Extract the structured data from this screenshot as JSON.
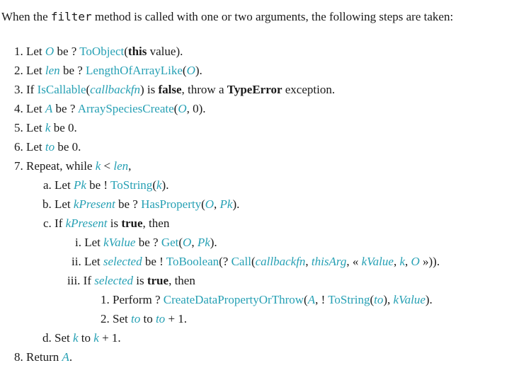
{
  "intro": {
    "before": "When the ",
    "code": "filter",
    "after": " method is called with one or two arguments, the following steps are taken:"
  },
  "steps": {
    "s1": {
      "num": "1.",
      "t1": "Let ",
      "v1": "O",
      "t2": " be ? ",
      "op1": "ToObject",
      "t3": "(",
      "k1": "this",
      "t4": " value)."
    },
    "s2": {
      "num": "2.",
      "t1": "Let ",
      "v1": "len",
      "t2": " be ? ",
      "op1": "LengthOfArrayLike",
      "t3": "(",
      "v2": "O",
      "t4": ")."
    },
    "s3": {
      "num": "3.",
      "t1": "If ",
      "op1": "IsCallable",
      "t2": "(",
      "v1": "callbackfn",
      "t3": ") is ",
      "k1": "false",
      "t4": ", throw a ",
      "k2": "TypeError",
      "t5": " exception."
    },
    "s4": {
      "num": "4.",
      "t1": "Let ",
      "v1": "A",
      "t2": " be ? ",
      "op1": "ArraySpeciesCreate",
      "t3": "(",
      "v2": "O",
      "t4": ", 0)."
    },
    "s5": {
      "num": "5.",
      "t1": "Let ",
      "v1": "k",
      "t2": " be 0."
    },
    "s6": {
      "num": "6.",
      "t1": "Let ",
      "v1": "to",
      "t2": " be 0."
    },
    "s7": {
      "num": "7.",
      "t1": "Repeat, while ",
      "v1": "k",
      "t2": " < ",
      "v2": "len",
      "t3": ","
    },
    "s7a": {
      "num": "a.",
      "t1": "Let ",
      "v1": "Pk",
      "t2": " be ! ",
      "op1": "ToString",
      "t3": "(",
      "v2": "k",
      "t4": ")."
    },
    "s7b": {
      "num": "b.",
      "t1": "Let ",
      "v1": "kPresent",
      "t2": " be ? ",
      "op1": "HasProperty",
      "t3": "(",
      "v2": "O",
      "t4": ", ",
      "v3": "Pk",
      "t5": ")."
    },
    "s7c": {
      "num": "c.",
      "t1": "If ",
      "v1": "kPresent",
      "t2": " is ",
      "k1": "true",
      "t3": ", then"
    },
    "s7ci": {
      "num": "i.",
      "t1": "Let ",
      "v1": "kValue",
      "t2": " be ? ",
      "op1": "Get",
      "t3": "(",
      "v2": "O",
      "t4": ", ",
      "v3": "Pk",
      "t5": ")."
    },
    "s7cii": {
      "num": "ii.",
      "t1": "Let ",
      "v1": "selected",
      "t2": " be ! ",
      "op1": "ToBoolean",
      "t3": "(? ",
      "op2": "Call",
      "t4": "(",
      "v2": "callbackfn",
      "t5": ", ",
      "v3": "thisArg",
      "t6": ", « ",
      "v4": "kValue",
      "t7": ", ",
      "v5": "k",
      "t8": ", ",
      "v6": "O",
      "t9": " »))."
    },
    "s7ciii": {
      "num": "iii.",
      "t1": "If ",
      "v1": "selected",
      "t2": " is ",
      "k1": "true",
      "t3": ", then"
    },
    "s7ciii1": {
      "num": "1.",
      "t1": "Perform ? ",
      "op1": "CreateDataPropertyOrThrow",
      "t2": "(",
      "v1": "A",
      "t3": ", ! ",
      "op2": "ToString",
      "t4": "(",
      "v2": "to",
      "t5": "), ",
      "v3": "kValue",
      "t6": ")."
    },
    "s7ciii2": {
      "num": "2.",
      "t1": "Set ",
      "v1": "to",
      "t2": " to ",
      "v2": "to",
      "t3": " + 1."
    },
    "s7d": {
      "num": "d.",
      "t1": "Set ",
      "v1": "k",
      "t2": " to ",
      "v2": "k",
      "t3": " + 1."
    },
    "s8": {
      "num": "8.",
      "t1": "Return ",
      "v1": "A",
      "t2": "."
    }
  },
  "colors": {
    "reference": "#26a0b4",
    "text": "#1a1a1a"
  }
}
